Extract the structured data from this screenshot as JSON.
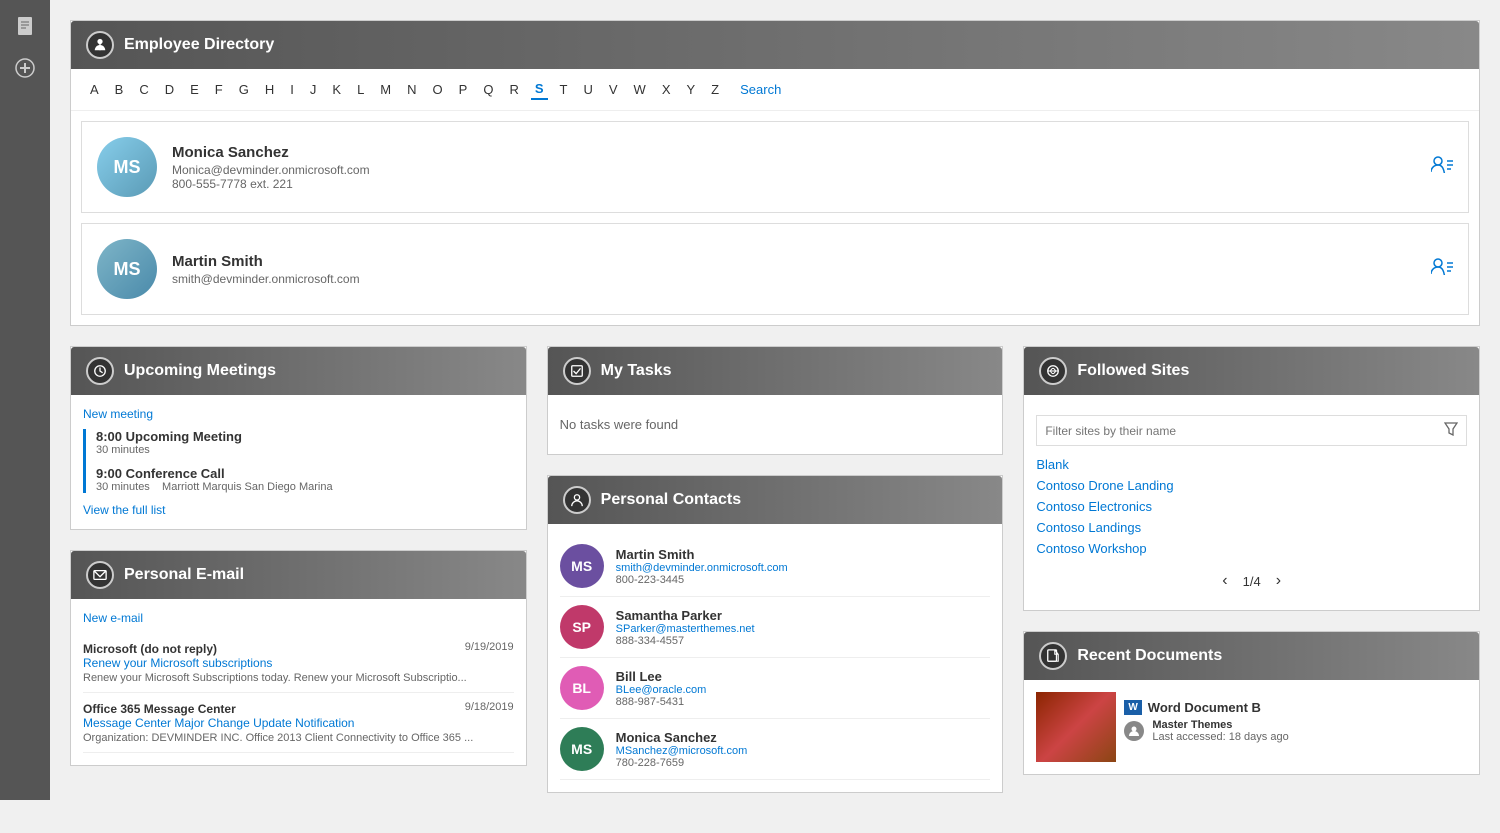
{
  "sidebar": {
    "icons": [
      {
        "name": "document-icon",
        "symbol": "📄"
      },
      {
        "name": "circle-icon",
        "symbol": "⊕"
      }
    ]
  },
  "employee_directory": {
    "header": "Employee Directory",
    "alphabet": [
      "A",
      "B",
      "C",
      "D",
      "E",
      "F",
      "G",
      "H",
      "I",
      "J",
      "K",
      "L",
      "M",
      "N",
      "O",
      "P",
      "Q",
      "R",
      "S",
      "T",
      "U",
      "V",
      "W",
      "X",
      "Y",
      "Z"
    ],
    "active_letter": "S",
    "search_label": "Search",
    "employees": [
      {
        "name": "Monica Sanchez",
        "email": "Monica@devminder.onmicrosoft.com",
        "phone": "800-555-7778 ext. 221",
        "initials": "MS",
        "avatar_color": "#87CEEB"
      },
      {
        "name": "Martin Smith",
        "email": "smith@devminder.onmicrosoft.com",
        "phone": "",
        "initials": "MS",
        "avatar_color": "#7EB5C8"
      }
    ]
  },
  "upcoming_meetings": {
    "header": "Upcoming Meetings",
    "new_link": "New meeting",
    "meetings": [
      {
        "time": "8:00",
        "title": "Upcoming Meeting",
        "duration": "30 minutes",
        "location": ""
      },
      {
        "time": "9:00",
        "title": "Conference Call",
        "duration": "30 minutes",
        "location": "Marriott Marquis San Diego Marina"
      }
    ],
    "view_all": "View the full list"
  },
  "personal_email": {
    "header": "Personal E-mail",
    "new_link": "New e-mail",
    "emails": [
      {
        "sender": "Microsoft (do not reply)",
        "subject": "Renew your Microsoft subscriptions",
        "date": "9/19/2019",
        "preview": "Renew your Microsoft Subscriptions today. Renew your Microsoft Subscriptio..."
      },
      {
        "sender": "Office 365 Message Center",
        "subject": "Message Center Major Change Update Notification",
        "date": "9/18/2019",
        "preview": "Organization: DEVMINDER INC. Office 2013 Client Connectivity to Office 365 ..."
      }
    ]
  },
  "my_tasks": {
    "header": "My Tasks",
    "empty_message": "No tasks were found"
  },
  "personal_contacts": {
    "header": "Personal Contacts",
    "contacts": [
      {
        "name": "Martin Smith",
        "email": "smith@devminder.onmicrosoft.com",
        "phone": "800-223-3445",
        "initials": "MS",
        "color": "#6B4FA0"
      },
      {
        "name": "Samantha Parker",
        "email": "SParker@masterthemes.net",
        "phone": "888-334-4557",
        "initials": "SP",
        "color": "#C0396A"
      },
      {
        "name": "Bill Lee",
        "email": "BLee@oracle.com",
        "phone": "888-987-5431",
        "initials": "BL",
        "color": "#E05CB5"
      },
      {
        "name": "Monica Sanchez",
        "email": "MSanchez@microsoft.com",
        "phone": "780-228-7659",
        "initials": "MS",
        "color": "#2E7D57"
      }
    ]
  },
  "followed_sites": {
    "header": "Followed Sites",
    "filter_placeholder": "Filter sites by their name",
    "sites": [
      {
        "name": "Blank"
      },
      {
        "name": "Contoso Drone Landing"
      },
      {
        "name": "Contoso Electronics"
      },
      {
        "name": "Contoso Landings"
      },
      {
        "name": "Contoso Workshop"
      }
    ],
    "pagination": {
      "current": "1/4",
      "prev": "‹",
      "next": "›"
    }
  },
  "recent_documents": {
    "header": "Recent Documents",
    "document": {
      "title": "Word Document B",
      "author": "Master Themes",
      "accessed": "Last accessed: 18 days ago"
    }
  }
}
